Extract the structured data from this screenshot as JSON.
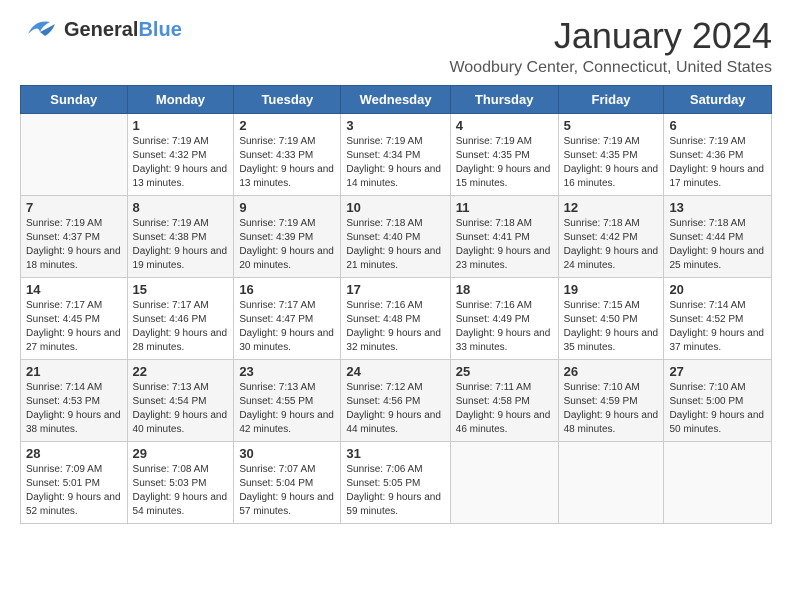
{
  "header": {
    "logo": {
      "general": "General",
      "blue": "Blue"
    },
    "title": "January 2024",
    "location": "Woodbury Center, Connecticut, United States"
  },
  "weekdays": [
    "Sunday",
    "Monday",
    "Tuesday",
    "Wednesday",
    "Thursday",
    "Friday",
    "Saturday"
  ],
  "weeks": [
    [
      {
        "num": "",
        "sunrise": "",
        "sunset": "",
        "daylight": ""
      },
      {
        "num": "1",
        "sunrise": "Sunrise: 7:19 AM",
        "sunset": "Sunset: 4:32 PM",
        "daylight": "Daylight: 9 hours and 13 minutes."
      },
      {
        "num": "2",
        "sunrise": "Sunrise: 7:19 AM",
        "sunset": "Sunset: 4:33 PM",
        "daylight": "Daylight: 9 hours and 13 minutes."
      },
      {
        "num": "3",
        "sunrise": "Sunrise: 7:19 AM",
        "sunset": "Sunset: 4:34 PM",
        "daylight": "Daylight: 9 hours and 14 minutes."
      },
      {
        "num": "4",
        "sunrise": "Sunrise: 7:19 AM",
        "sunset": "Sunset: 4:35 PM",
        "daylight": "Daylight: 9 hours and 15 minutes."
      },
      {
        "num": "5",
        "sunrise": "Sunrise: 7:19 AM",
        "sunset": "Sunset: 4:35 PM",
        "daylight": "Daylight: 9 hours and 16 minutes."
      },
      {
        "num": "6",
        "sunrise": "Sunrise: 7:19 AM",
        "sunset": "Sunset: 4:36 PM",
        "daylight": "Daylight: 9 hours and 17 minutes."
      }
    ],
    [
      {
        "num": "7",
        "sunrise": "Sunrise: 7:19 AM",
        "sunset": "Sunset: 4:37 PM",
        "daylight": "Daylight: 9 hours and 18 minutes."
      },
      {
        "num": "8",
        "sunrise": "Sunrise: 7:19 AM",
        "sunset": "Sunset: 4:38 PM",
        "daylight": "Daylight: 9 hours and 19 minutes."
      },
      {
        "num": "9",
        "sunrise": "Sunrise: 7:19 AM",
        "sunset": "Sunset: 4:39 PM",
        "daylight": "Daylight: 9 hours and 20 minutes."
      },
      {
        "num": "10",
        "sunrise": "Sunrise: 7:18 AM",
        "sunset": "Sunset: 4:40 PM",
        "daylight": "Daylight: 9 hours and 21 minutes."
      },
      {
        "num": "11",
        "sunrise": "Sunrise: 7:18 AM",
        "sunset": "Sunset: 4:41 PM",
        "daylight": "Daylight: 9 hours and 23 minutes."
      },
      {
        "num": "12",
        "sunrise": "Sunrise: 7:18 AM",
        "sunset": "Sunset: 4:42 PM",
        "daylight": "Daylight: 9 hours and 24 minutes."
      },
      {
        "num": "13",
        "sunrise": "Sunrise: 7:18 AM",
        "sunset": "Sunset: 4:44 PM",
        "daylight": "Daylight: 9 hours and 25 minutes."
      }
    ],
    [
      {
        "num": "14",
        "sunrise": "Sunrise: 7:17 AM",
        "sunset": "Sunset: 4:45 PM",
        "daylight": "Daylight: 9 hours and 27 minutes."
      },
      {
        "num": "15",
        "sunrise": "Sunrise: 7:17 AM",
        "sunset": "Sunset: 4:46 PM",
        "daylight": "Daylight: 9 hours and 28 minutes."
      },
      {
        "num": "16",
        "sunrise": "Sunrise: 7:17 AM",
        "sunset": "Sunset: 4:47 PM",
        "daylight": "Daylight: 9 hours and 30 minutes."
      },
      {
        "num": "17",
        "sunrise": "Sunrise: 7:16 AM",
        "sunset": "Sunset: 4:48 PM",
        "daylight": "Daylight: 9 hours and 32 minutes."
      },
      {
        "num": "18",
        "sunrise": "Sunrise: 7:16 AM",
        "sunset": "Sunset: 4:49 PM",
        "daylight": "Daylight: 9 hours and 33 minutes."
      },
      {
        "num": "19",
        "sunrise": "Sunrise: 7:15 AM",
        "sunset": "Sunset: 4:50 PM",
        "daylight": "Daylight: 9 hours and 35 minutes."
      },
      {
        "num": "20",
        "sunrise": "Sunrise: 7:14 AM",
        "sunset": "Sunset: 4:52 PM",
        "daylight": "Daylight: 9 hours and 37 minutes."
      }
    ],
    [
      {
        "num": "21",
        "sunrise": "Sunrise: 7:14 AM",
        "sunset": "Sunset: 4:53 PM",
        "daylight": "Daylight: 9 hours and 38 minutes."
      },
      {
        "num": "22",
        "sunrise": "Sunrise: 7:13 AM",
        "sunset": "Sunset: 4:54 PM",
        "daylight": "Daylight: 9 hours and 40 minutes."
      },
      {
        "num": "23",
        "sunrise": "Sunrise: 7:13 AM",
        "sunset": "Sunset: 4:55 PM",
        "daylight": "Daylight: 9 hours and 42 minutes."
      },
      {
        "num": "24",
        "sunrise": "Sunrise: 7:12 AM",
        "sunset": "Sunset: 4:56 PM",
        "daylight": "Daylight: 9 hours and 44 minutes."
      },
      {
        "num": "25",
        "sunrise": "Sunrise: 7:11 AM",
        "sunset": "Sunset: 4:58 PM",
        "daylight": "Daylight: 9 hours and 46 minutes."
      },
      {
        "num": "26",
        "sunrise": "Sunrise: 7:10 AM",
        "sunset": "Sunset: 4:59 PM",
        "daylight": "Daylight: 9 hours and 48 minutes."
      },
      {
        "num": "27",
        "sunrise": "Sunrise: 7:10 AM",
        "sunset": "Sunset: 5:00 PM",
        "daylight": "Daylight: 9 hours and 50 minutes."
      }
    ],
    [
      {
        "num": "28",
        "sunrise": "Sunrise: 7:09 AM",
        "sunset": "Sunset: 5:01 PM",
        "daylight": "Daylight: 9 hours and 52 minutes."
      },
      {
        "num": "29",
        "sunrise": "Sunrise: 7:08 AM",
        "sunset": "Sunset: 5:03 PM",
        "daylight": "Daylight: 9 hours and 54 minutes."
      },
      {
        "num": "30",
        "sunrise": "Sunrise: 7:07 AM",
        "sunset": "Sunset: 5:04 PM",
        "daylight": "Daylight: 9 hours and 57 minutes."
      },
      {
        "num": "31",
        "sunrise": "Sunrise: 7:06 AM",
        "sunset": "Sunset: 5:05 PM",
        "daylight": "Daylight: 9 hours and 59 minutes."
      },
      {
        "num": "",
        "sunrise": "",
        "sunset": "",
        "daylight": ""
      },
      {
        "num": "",
        "sunrise": "",
        "sunset": "",
        "daylight": ""
      },
      {
        "num": "",
        "sunrise": "",
        "sunset": "",
        "daylight": ""
      }
    ]
  ]
}
